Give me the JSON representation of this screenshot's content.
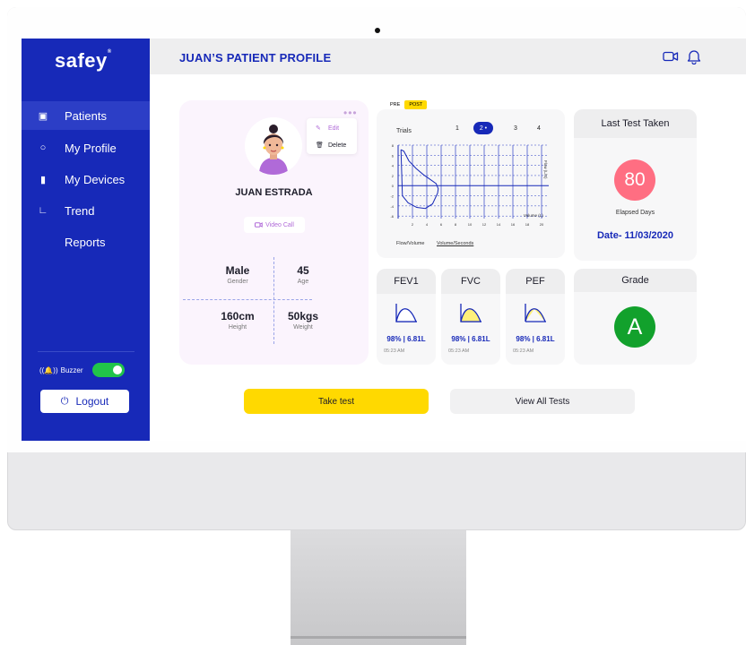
{
  "app": {
    "logo": "safey",
    "logo_mark": "®"
  },
  "header": {
    "title": "JUAN’S PATIENT PROFILE"
  },
  "sidebar": {
    "items": [
      {
        "label": "Patients",
        "active": true
      },
      {
        "label": "My Profile"
      },
      {
        "label": "My Devices"
      },
      {
        "label": "Trend"
      },
      {
        "label": "Reports"
      }
    ],
    "buzzer_label": "Buzzer",
    "buzzer_on": true,
    "logout_label": "Logout"
  },
  "profile": {
    "name": "JUAN ESTRADA",
    "menu": {
      "edit": "Edit",
      "delete": "Delete"
    },
    "video_call": "Video Call",
    "stats": {
      "gender": {
        "value": "Male",
        "label": "Gender"
      },
      "age": {
        "value": "45",
        "label": "Age"
      },
      "height": {
        "value": "160cm",
        "label": "Height"
      },
      "weight": {
        "value": "50kgs",
        "label": "Weight"
      }
    }
  },
  "chart": {
    "pre": "PRE",
    "post": "POST",
    "trials_label": "Trials",
    "trials": [
      "1",
      "2 •",
      "3",
      "4"
    ],
    "selected_trial": 1,
    "tabs": [
      "Flow/Volume",
      "Volume/Seconds"
    ],
    "y_axis_label": "Flow (L/S)",
    "x_axis_label": "Volume (L)"
  },
  "chart_data": {
    "type": "line",
    "xlabel": "Volume (L)",
    "ylabel": "Flow (L/S)",
    "xlim": [
      0,
      21
    ],
    "ylim": [
      -6.5,
      8
    ],
    "x_ticks": [
      "2",
      "4",
      "6",
      "8",
      "10",
      "12",
      "14",
      "16",
      "18",
      "20"
    ],
    "y_ticks": [
      "8",
      "6",
      "4",
      "2",
      "0",
      "-2",
      "-4",
      "-6"
    ],
    "grid": true,
    "series": [
      {
        "x": [
          0.4,
          0.8,
          1.5,
          2.5,
          3.5,
          4.5,
          5.3,
          5.6,
          5.5,
          4.8,
          3.8,
          2.6,
          1.4,
          0.6,
          0.4
        ],
        "y": [
          7.1,
          6.8,
          4.9,
          3.4,
          2.2,
          1.2,
          0.4,
          -0.6,
          -1.5,
          -3.6,
          -4.5,
          -4.3,
          -3.4,
          -2.0,
          7.1
        ]
      }
    ]
  },
  "metrics": [
    {
      "name": "FEV1",
      "value": "98% | 6.81L",
      "time": "05:23 AM",
      "fill": "#ffffff"
    },
    {
      "name": "FVC",
      "value": "98% | 6.81L",
      "time": "05:23 AM",
      "fill": "#fff07a"
    },
    {
      "name": "PEF",
      "value": "98% | 6.81L",
      "time": "05:23 AM",
      "fill": "#fff07a"
    }
  ],
  "last_test": {
    "title": "Last Test Taken",
    "days": "80",
    "elapsed_label": "Elapsed Days",
    "date": "Date- 11/03/2020"
  },
  "grade": {
    "title": "Grade",
    "value": "A"
  },
  "actions": {
    "take_test": "Take test",
    "view_all": "View All Tests"
  },
  "colors": {
    "primary": "#1729b8",
    "accent": "#ffd900",
    "days_badge": "#ff6e82",
    "grade_badge": "#12a12c"
  }
}
